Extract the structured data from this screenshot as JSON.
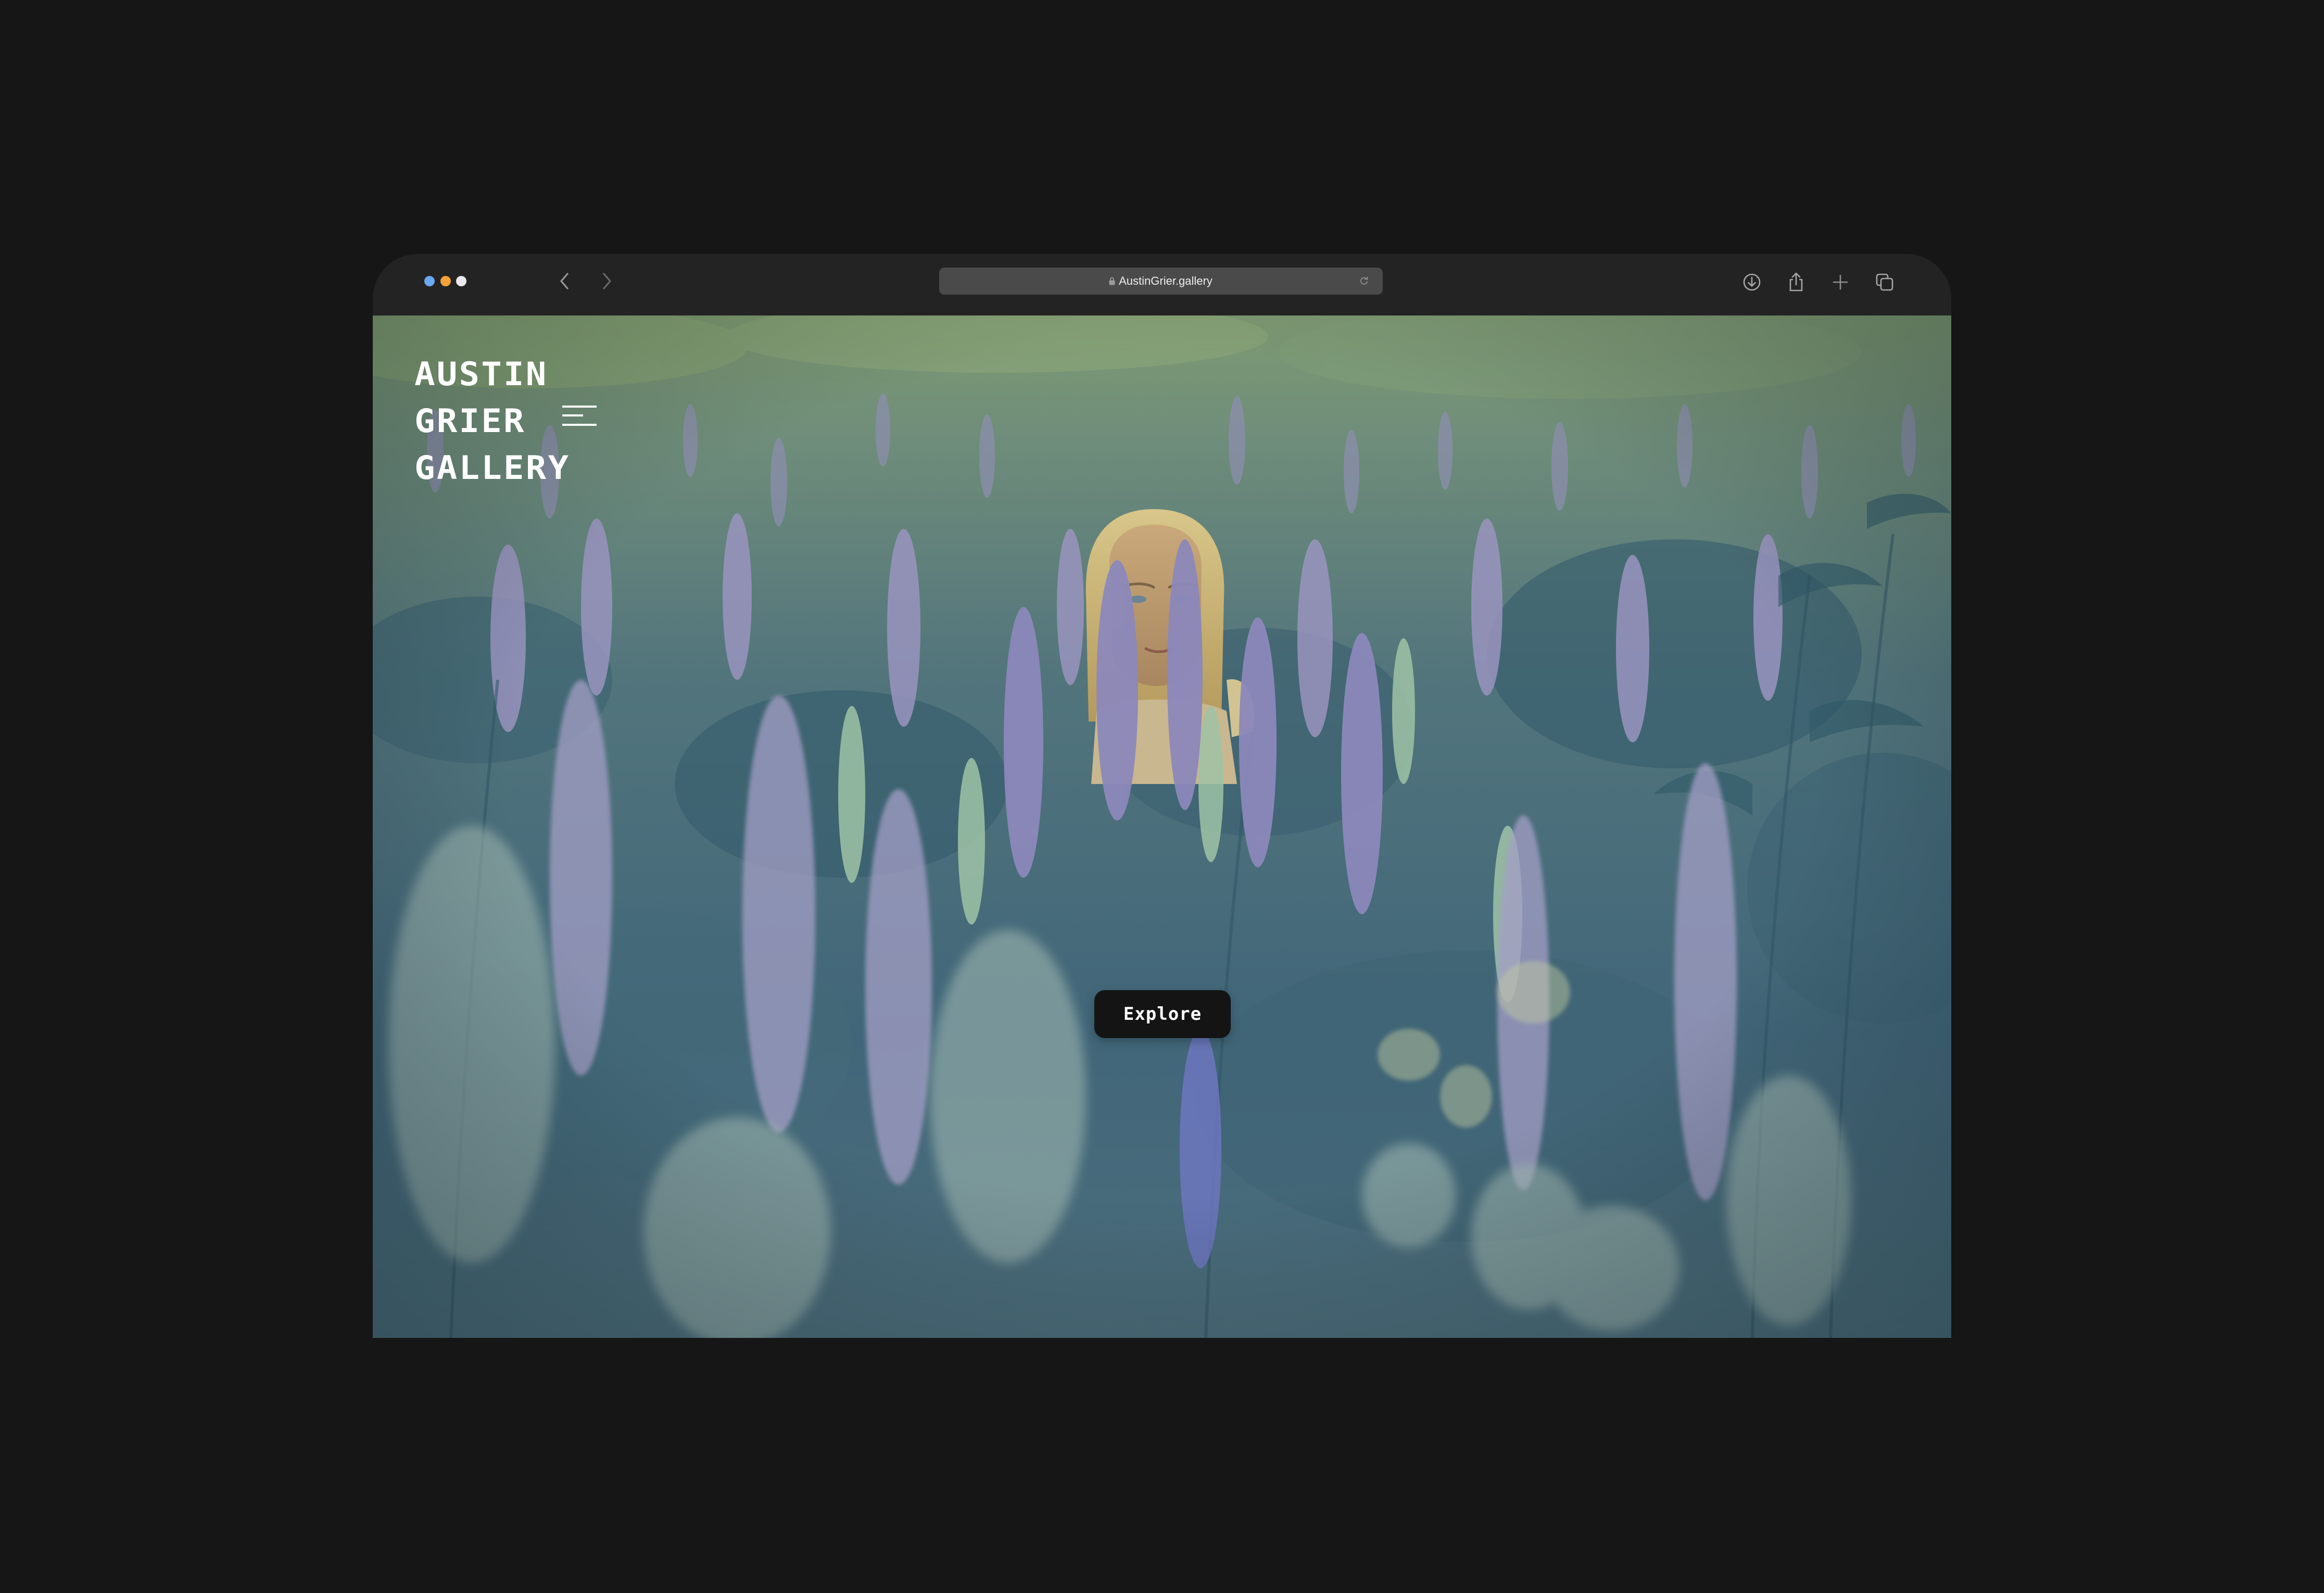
{
  "browser": {
    "url": "AustinGrier.gallery",
    "window_dot_colors": [
      "#6aa8f0",
      "#f2a23a",
      "#e8e8ee"
    ],
    "icons": {
      "back": "chevron-left-icon",
      "forward": "chevron-right-icon",
      "lock": "lock-icon",
      "reload": "reload-icon",
      "download": "download-icon",
      "share": "share-icon",
      "new_tab": "plus-icon",
      "tabs": "tabs-overview-icon"
    }
  },
  "site": {
    "brand_lines": [
      "AUSTIN",
      "GRIER",
      "GALLERY"
    ],
    "menu_icon": "hamburger-menu-icon",
    "cta_label": "Explore",
    "hero": "hero-image-lupine-field-portrait"
  },
  "colors": {
    "page_background": "#161616",
    "browser_chrome": "#232323",
    "address_bar": "#4a4a4a",
    "button_background": "#141414",
    "text_light": "#ffffff"
  }
}
